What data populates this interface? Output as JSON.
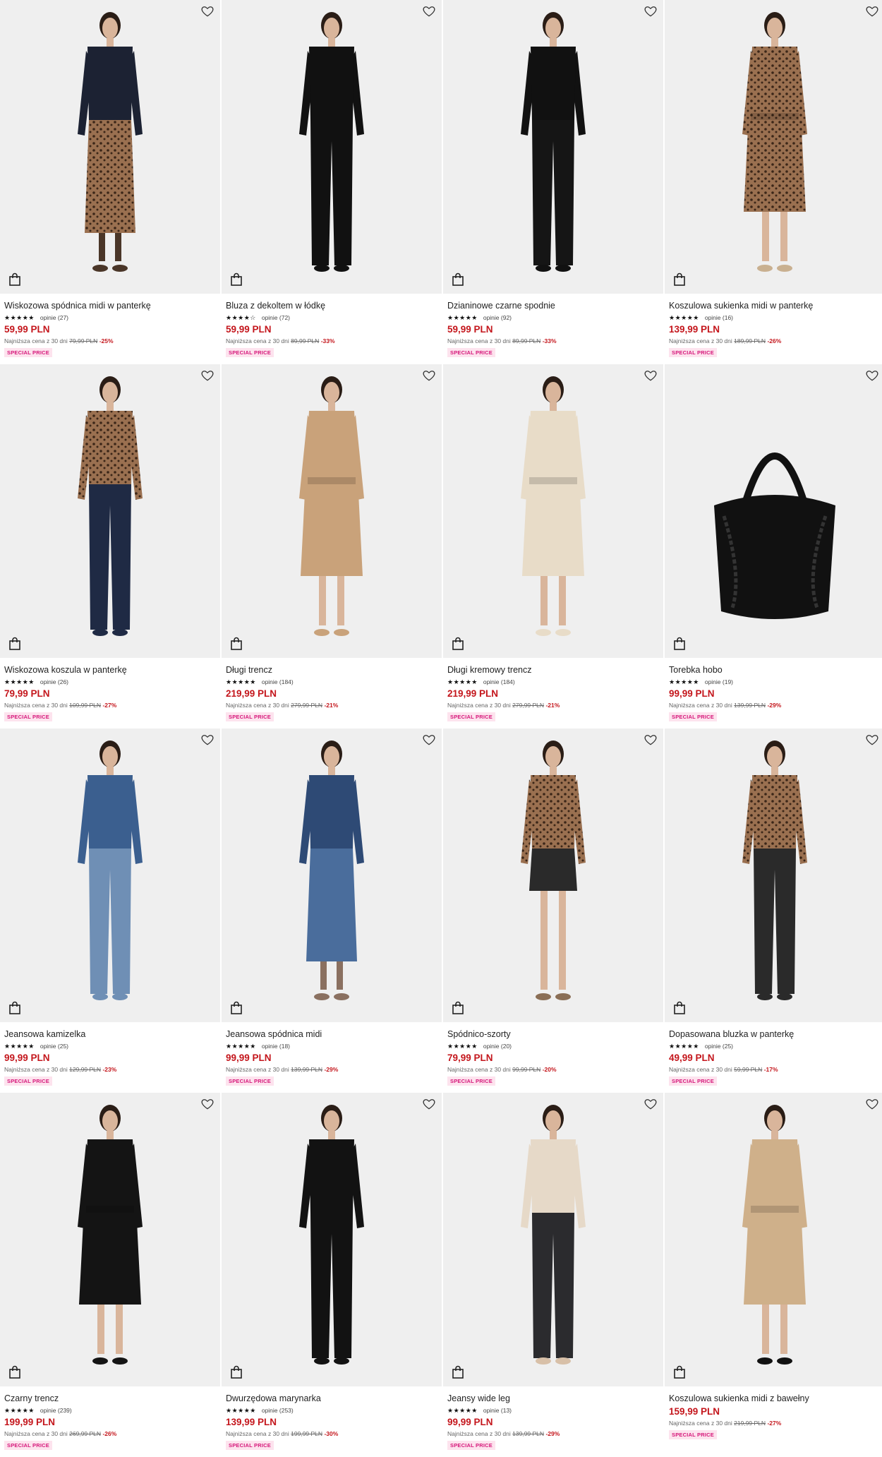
{
  "colors": {
    "price_red": "#c4161c",
    "badge_bg": "#fde3ee",
    "badge_text": "#d6177a",
    "photo_bg": "#efefef"
  },
  "icons": {
    "wishlist": "heart-icon",
    "cart": "shopping-bag-icon"
  },
  "products": [
    {
      "name": "Wiskozowa spódnica midi w panterkę",
      "stars": "★★★★★",
      "reviews": "opinie (27)",
      "price": "59,99 PLN",
      "lowest_label": "Najniższa cena z 30 dni",
      "old_price": "79,99 PLN",
      "discount": "-25%",
      "badge": "SPECIAL PRICE",
      "rating": 4.5,
      "look": {
        "top": "#1c2233",
        "bottom": "#6b4a33",
        "bottom_len": "skirt",
        "shoes": "#4a3628",
        "pattern": true
      }
    },
    {
      "name": "Bluza z dekoltem w łódkę",
      "stars": "★★★★☆",
      "reviews": "opinie (72)",
      "price": "59,99 PLN",
      "lowest_label": "Najniższa cena z 30 dni",
      "old_price": "89,99 PLN",
      "discount": "-33%",
      "badge": "SPECIAL PRICE",
      "rating": 4,
      "look": {
        "top": "#111111",
        "bottom": "#111111",
        "bottom_len": "crop",
        "shoes": "#111111",
        "pattern": false
      }
    },
    {
      "name": "Dzianinowe czarne spodnie",
      "stars": "★★★★★",
      "reviews": "opinie (92)",
      "price": "59,99 PLN",
      "lowest_label": "Najniższa cena z 30 dni",
      "old_price": "89,99 PLN",
      "discount": "-33%",
      "badge": "SPECIAL PRICE",
      "rating": 4.5,
      "look": {
        "top": "#111111",
        "bottom": "#151515",
        "bottom_len": "pants",
        "shoes": "#111111",
        "pattern": false
      }
    },
    {
      "name": "Koszulowa sukienka midi w panterkę",
      "stars": "★★★★★",
      "reviews": "opinie (16)",
      "price": "139,99 PLN",
      "lowest_label": "Najniższa cena z 30 dni",
      "old_price": "189,99 PLN",
      "discount": "-26%",
      "badge": "SPECIAL PRICE",
      "rating": 4.5,
      "look": {
        "top": "#6b4a33",
        "bottom": "#6b4a33",
        "bottom_len": "dress",
        "shoes": "#c9b090",
        "pattern": true
      }
    },
    {
      "name": "Wiskozowa koszula w panterkę",
      "stars": "★★★★★",
      "reviews": "opinie (26)",
      "price": "79,99 PLN",
      "lowest_label": "Najniższa cena z 30 dni",
      "old_price": "109,99 PLN",
      "discount": "-27%",
      "badge": "SPECIAL PRICE",
      "rating": 5,
      "look": {
        "top": "#7a5236",
        "bottom": "#1f2a44",
        "bottom_len": "crop",
        "shoes": "#1f2a44",
        "pattern": true
      }
    },
    {
      "name": "Długi trencz",
      "stars": "★★★★★",
      "reviews": "opinie (184)",
      "price": "219,99 PLN",
      "lowest_label": "Najniższa cena z 30 dni",
      "old_price": "279,99 PLN",
      "discount": "-21%",
      "badge": "SPECIAL PRICE",
      "rating": 4.5,
      "look": {
        "top": "#c9a27a",
        "bottom": "#c9a27a",
        "bottom_len": "coat",
        "shoes": "#c9a27a",
        "pattern": false
      }
    },
    {
      "name": "Długi kremowy trencz",
      "stars": "★★★★★",
      "reviews": "opinie (184)",
      "price": "219,99 PLN",
      "lowest_label": "Najniższa cena z 30 dni",
      "old_price": "279,99 PLN",
      "discount": "-21%",
      "badge": "SPECIAL PRICE",
      "rating": 4.5,
      "look": {
        "top": "#e8dcc8",
        "bottom": "#e8dcc8",
        "bottom_len": "coat",
        "shoes": "#e8dcc8",
        "pattern": false
      }
    },
    {
      "name": "Torebka hobo",
      "stars": "★★★★★",
      "reviews": "opinie (19)",
      "price": "99,99 PLN",
      "lowest_label": "Najniższa cena z 30 dni",
      "old_price": "139,99 PLN",
      "discount": "-29%",
      "badge": "SPECIAL PRICE",
      "rating": 4.5,
      "look": {
        "top": "#111111",
        "bottom": "#111111",
        "bottom_len": "bag",
        "shoes": "#111111",
        "pattern": false
      }
    },
    {
      "name": "Jeansowa kamizelka",
      "stars": "★★★★★",
      "reviews": "opinie (25)",
      "price": "99,99 PLN",
      "lowest_label": "Najniższa cena z 30 dni",
      "old_price": "129,99 PLN",
      "discount": "-23%",
      "badge": "SPECIAL PRICE",
      "rating": 4.5,
      "look": {
        "top": "#3b5f8f",
        "bottom": "#6f8fb5",
        "bottom_len": "crop",
        "shoes": "#6f8fb5",
        "pattern": false
      }
    },
    {
      "name": "Jeansowa spódnica midi",
      "stars": "★★★★★",
      "reviews": "opinie (18)",
      "price": "99,99 PLN",
      "lowest_label": "Najniższa cena z 30 dni",
      "old_price": "139,99 PLN",
      "discount": "-29%",
      "badge": "SPECIAL PRICE",
      "rating": 5,
      "look": {
        "top": "#2e4a75",
        "bottom": "#4a6d9c",
        "bottom_len": "skirt",
        "shoes": "#8a7060",
        "pattern": false
      }
    },
    {
      "name": "Spódnico-szorty",
      "stars": "★★★★★",
      "reviews": "opinie (20)",
      "price": "79,99 PLN",
      "lowest_label": "Najniższa cena z 30 dni",
      "old_price": "99,99 PLN",
      "discount": "-20%",
      "badge": "SPECIAL PRICE",
      "rating": 5,
      "look": {
        "top": "#8a6040",
        "bottom": "#2a2a2a",
        "bottom_len": "mini",
        "shoes": "#8a6e55",
        "pattern": true
      }
    },
    {
      "name": "Dopasowana bluzka w panterkę",
      "stars": "★★★★★",
      "reviews": "opinie (25)",
      "price": "49,99 PLN",
      "lowest_label": "Najniższa cena z 30 dni",
      "old_price": "59,99 PLN",
      "discount": "-17%",
      "badge": "SPECIAL PRICE",
      "rating": 5,
      "look": {
        "top": "#8a6040",
        "bottom": "#2a2a2a",
        "bottom_len": "crop",
        "shoes": "#2a2a2a",
        "pattern": true
      }
    },
    {
      "name": "Czarny trencz",
      "stars": "★★★★★",
      "reviews": "opinie (239)",
      "price": "199,99 PLN",
      "lowest_label": "Najniższa cena z 30 dni",
      "old_price": "269,99 PLN",
      "discount": "-26%",
      "badge": "SPECIAL PRICE",
      "rating": 5,
      "look": {
        "top": "#141414",
        "bottom": "#141414",
        "bottom_len": "coat",
        "shoes": "#141414",
        "pattern": false
      }
    },
    {
      "name": "Dwurzędowa marynarka",
      "stars": "★★★★★",
      "reviews": "opinie (253)",
      "price": "139,99 PLN",
      "lowest_label": "Najniższa cena z 30 dni",
      "old_price": "199,99 PLN",
      "discount": "-30%",
      "badge": "SPECIAL PRICE",
      "rating": 5,
      "look": {
        "top": "#121212",
        "bottom": "#121212",
        "bottom_len": "crop",
        "shoes": "#121212",
        "pattern": false
      }
    },
    {
      "name": "Jeansy wide leg",
      "stars": "★★★★★",
      "reviews": "opinie (13)",
      "price": "99,99 PLN",
      "lowest_label": "Najniższa cena z 30 dni",
      "old_price": "139,99 PLN",
      "discount": "-29%",
      "badge": "SPECIAL PRICE",
      "rating": 4.5,
      "look": {
        "top": "#e6d9c8",
        "bottom": "#2b2b2e",
        "bottom_len": "pants",
        "shoes": "#d8c0a8",
        "pattern": false
      }
    },
    {
      "name": "Koszulowa sukienka midi z bawełny",
      "stars": "",
      "reviews": "",
      "price": "159,99 PLN",
      "lowest_label": "Najniższa cena z 30 dni",
      "old_price": "219,99 PLN",
      "discount": "-27%",
      "badge": "SPECIAL PRICE",
      "rating": null,
      "look": {
        "top": "#cfb08a",
        "bottom": "#cfb08a",
        "bottom_len": "dress",
        "shoes": "#111111",
        "pattern": false
      }
    }
  ]
}
